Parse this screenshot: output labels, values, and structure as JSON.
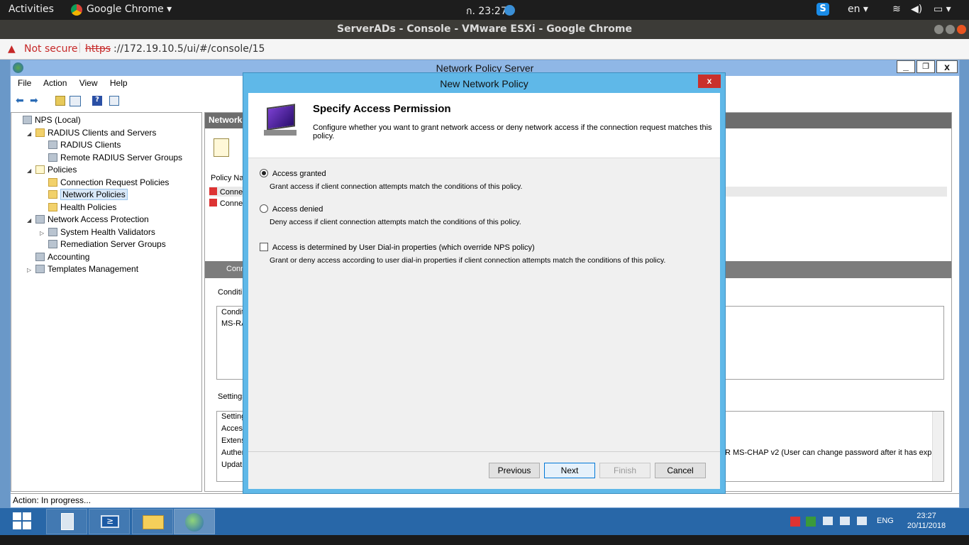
{
  "topbar": {
    "activities": "Activities",
    "app_menu": "Google Chrome ▾",
    "clock": "ก. 23:27",
    "lang": "en ▾"
  },
  "chrome": {
    "window_title": "ServerADs - Console - VMware ESXi - Google Chrome",
    "not_secure": "Not secure",
    "url_scheme": "https",
    "url_rest": "://172.19.10.5/ui/#/console/15"
  },
  "nps": {
    "title": "Network Policy Server",
    "menu": [
      "File",
      "Action",
      "View",
      "Help"
    ],
    "tree": [
      {
        "label": "NPS (Local)",
        "indent": 0,
        "icon": "server-icon",
        "expander": ""
      },
      {
        "label": "RADIUS Clients and Servers",
        "indent": 1,
        "icon": "folder-icon",
        "expander": "◢"
      },
      {
        "label": "RADIUS Clients",
        "indent": 2,
        "icon": "server-icon",
        "expander": ""
      },
      {
        "label": "Remote RADIUS Server Groups",
        "indent": 2,
        "icon": "server-icon",
        "expander": ""
      },
      {
        "label": "Policies",
        "indent": 1,
        "icon": "policy-icon",
        "expander": "◢"
      },
      {
        "label": "Connection Request Policies",
        "indent": 2,
        "icon": "folder-icon",
        "expander": ""
      },
      {
        "label": "Network Policies",
        "indent": 2,
        "icon": "folder-icon",
        "expander": ""
      },
      {
        "label": "Health Policies",
        "indent": 2,
        "icon": "folder-icon",
        "expander": ""
      },
      {
        "label": "Network Access Protection",
        "indent": 1,
        "icon": "shield-icon",
        "expander": "◢"
      },
      {
        "label": "System Health Validators",
        "indent": 2,
        "icon": "monitor-icon",
        "expander": "▷"
      },
      {
        "label": "Remediation Server Groups",
        "indent": 2,
        "icon": "server-icon",
        "expander": ""
      },
      {
        "label": "Accounting",
        "indent": 1,
        "icon": "accounting-icon",
        "expander": ""
      },
      {
        "label": "Templates Management",
        "indent": 1,
        "icon": "templates-icon",
        "expander": "▷"
      }
    ],
    "right_header": "Network",
    "policy_name_col": "Policy Nar",
    "row1": "Conne",
    "row2": "Conne",
    "section_label": "Conn",
    "conditions_label": "Conditi",
    "cond_col": "Conditi",
    "cond_val": "MS-RA",
    "settings_label": "Settings",
    "settings_rows": [
      "Setting",
      "Acces",
      "Extens",
      "Auther",
      "Update"
    ],
    "auth_right": "R MS-CHAP v2 (User can change password after it has expi...",
    "status": "Action:  In progress..."
  },
  "dialog": {
    "title": "New Network Policy",
    "heading": "Specify Access Permission",
    "description": "Configure whether you want to grant network access or deny network access if the connection request matches this policy.",
    "option_granted": "Access granted",
    "option_granted_desc": "Grant access if client connection attempts match the conditions of this policy.",
    "option_denied": "Access denied",
    "option_denied_desc": "Deny access if client connection attempts match the conditions of this policy.",
    "option_dialin": "Access is determined by User Dial-in properties (which override NPS policy)",
    "option_dialin_desc": "Grant or deny access according to user dial-in properties if client connection attempts match the conditions of this policy.",
    "btn_previous": "Previous",
    "btn_next": "Next",
    "btn_finish": "Finish",
    "btn_cancel": "Cancel"
  },
  "taskbar": {
    "lang": "ENG",
    "time": "23:27",
    "date": "20/11/2018"
  },
  "colors": {
    "dialog_frame": "#5fb8e8",
    "taskbar": "#2867a8",
    "close_red": "#c9302c"
  }
}
